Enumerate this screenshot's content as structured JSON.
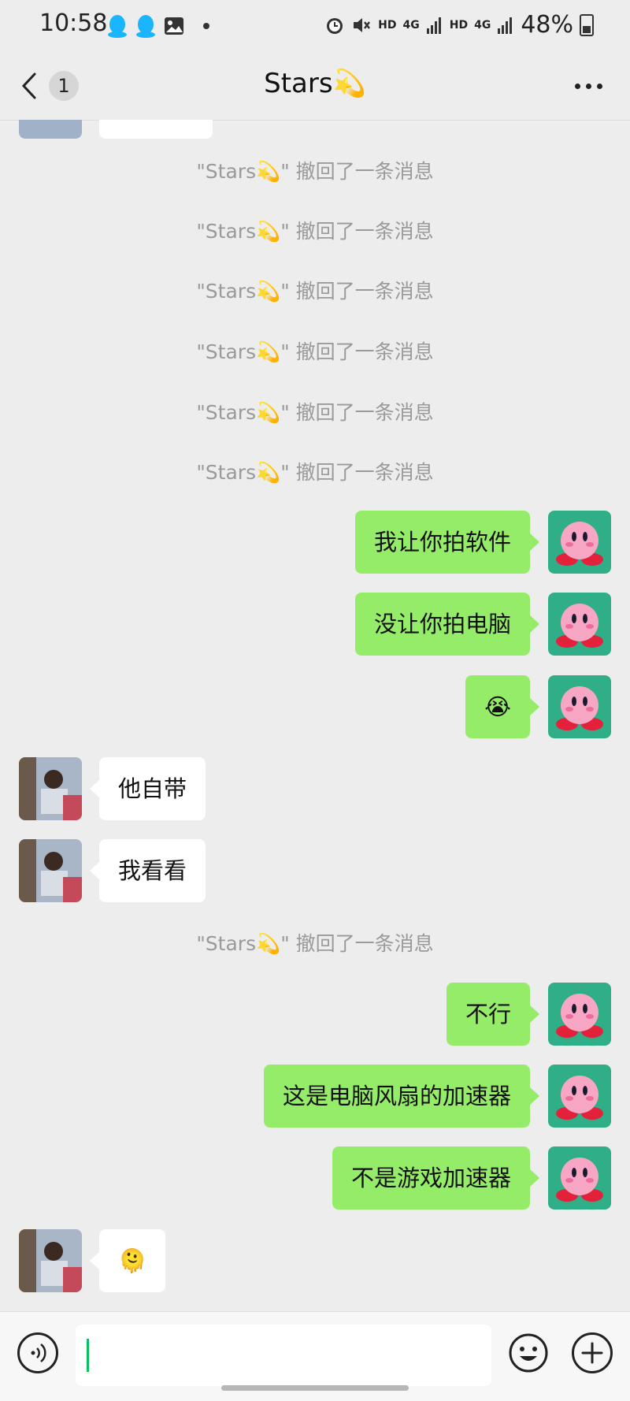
{
  "status_bar": {
    "time": "10:58",
    "hd1": "HD",
    "net1": "4G",
    "hd2": "HD",
    "net2": "4G",
    "battery_pct": "48%",
    "icons": [
      "qq-icon",
      "qq-icon",
      "gallery-icon",
      "alarm-icon",
      "mute-icon",
      "signal-icon",
      "battery-icon"
    ]
  },
  "nav": {
    "unread_count": "1",
    "title": "Stars💫"
  },
  "messages": [
    {
      "type": "system",
      "text": "\"Stars💫\" 撤回了一条消息"
    },
    {
      "type": "system",
      "text": "\"Stars💫\" 撤回了一条消息"
    },
    {
      "type": "system",
      "text": "\"Stars💫\" 撤回了一条消息"
    },
    {
      "type": "system",
      "text": "\"Stars💫\" 撤回了一条消息"
    },
    {
      "type": "system",
      "text": "\"Stars💫\" 撤回了一条消息"
    },
    {
      "type": "system",
      "text": "\"Stars💫\" 撤回了一条消息"
    },
    {
      "type": "out",
      "text": "我让你拍软件"
    },
    {
      "type": "out",
      "text": "没让你拍电脑"
    },
    {
      "type": "out",
      "text": "😭"
    },
    {
      "type": "in",
      "text": "他自带"
    },
    {
      "type": "in",
      "text": "我看看"
    },
    {
      "type": "system",
      "text": "\"Stars💫\" 撤回了一条消息"
    },
    {
      "type": "out",
      "text": "不行"
    },
    {
      "type": "out",
      "text": "这是电脑风扇的加速器"
    },
    {
      "type": "out",
      "text": "不是游戏加速器"
    },
    {
      "type": "in",
      "text": "🫠"
    }
  ],
  "colors": {
    "background": "#ededed",
    "outgoing_bubble": "#95ec69",
    "incoming_bubble": "#ffffff",
    "system_text": "#9a9a9a",
    "caret": "#07c160"
  }
}
